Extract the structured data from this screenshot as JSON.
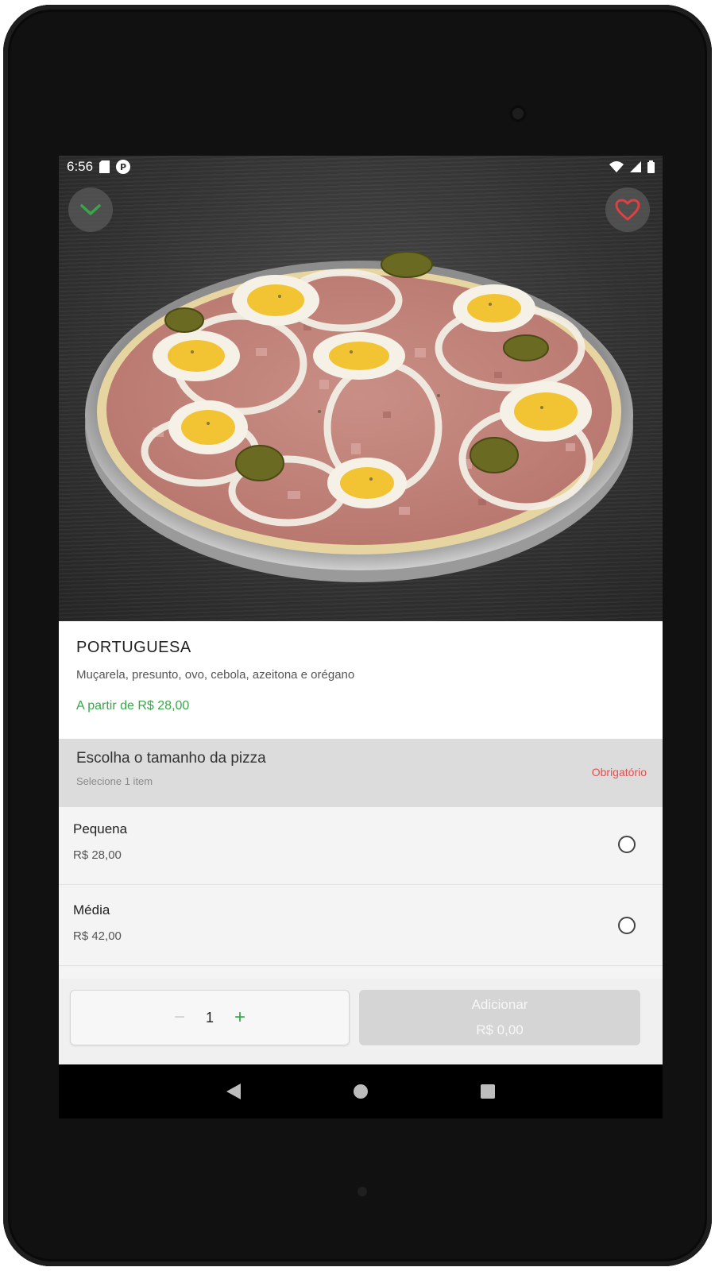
{
  "status_bar": {
    "time": "6:56",
    "left_icons": [
      "sd-card-icon",
      "p-notification-icon"
    ],
    "right_icons": [
      "wifi-icon",
      "signal-icon",
      "battery-icon"
    ]
  },
  "header": {
    "back_icon": "chevron-down-icon",
    "favorite_icon": "heart-icon",
    "accent_color": "#3aa64a",
    "heart_color": "#e04040"
  },
  "product": {
    "name": "PORTUGUESA",
    "description": "Muçarela, presunto, ovo, cebola, azeitona e orégano",
    "price_from": "A partir de R$ 28,00"
  },
  "size_section": {
    "title": "Escolha o tamanho da pizza",
    "subtitle": "Selecione 1 item",
    "required_label": "Obrigatório"
  },
  "options": [
    {
      "name": "Pequena",
      "price": "R$ 28,00",
      "selected": false
    },
    {
      "name": "Média",
      "price": "R$ 42,00",
      "selected": false
    }
  ],
  "cart": {
    "minus": "−",
    "quantity": "1",
    "plus": "+",
    "add_label": "Adicionar",
    "add_total": "R$ 0,00"
  },
  "nav": {
    "icons": [
      "back-triangle-icon",
      "home-circle-icon",
      "recents-square-icon"
    ]
  }
}
